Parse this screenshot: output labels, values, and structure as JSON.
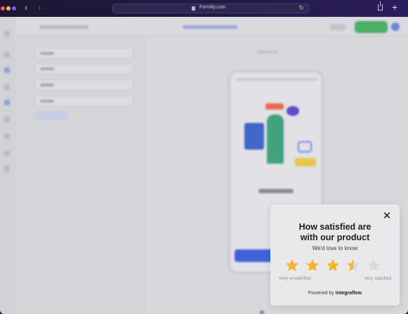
{
  "browser": {
    "url": "Formily.com"
  },
  "survey": {
    "question": "How satisfied are with our product",
    "subtitle": "We'd love to know",
    "rating": 3.5,
    "max_rating": 5,
    "label_low": "Very unsatisfied",
    "label_high": "Very satisfied",
    "powered_prefix": "Powered by",
    "powered_brand": "integraflow",
    "star_color": "#f1b62f",
    "star_empty_color": "#d9d9dd"
  },
  "icons": {
    "close": "close-icon",
    "star": "star-icon",
    "lock": "lock-icon",
    "reload": "reload-icon",
    "share": "share-icon",
    "new_tab": "plus-icon"
  }
}
